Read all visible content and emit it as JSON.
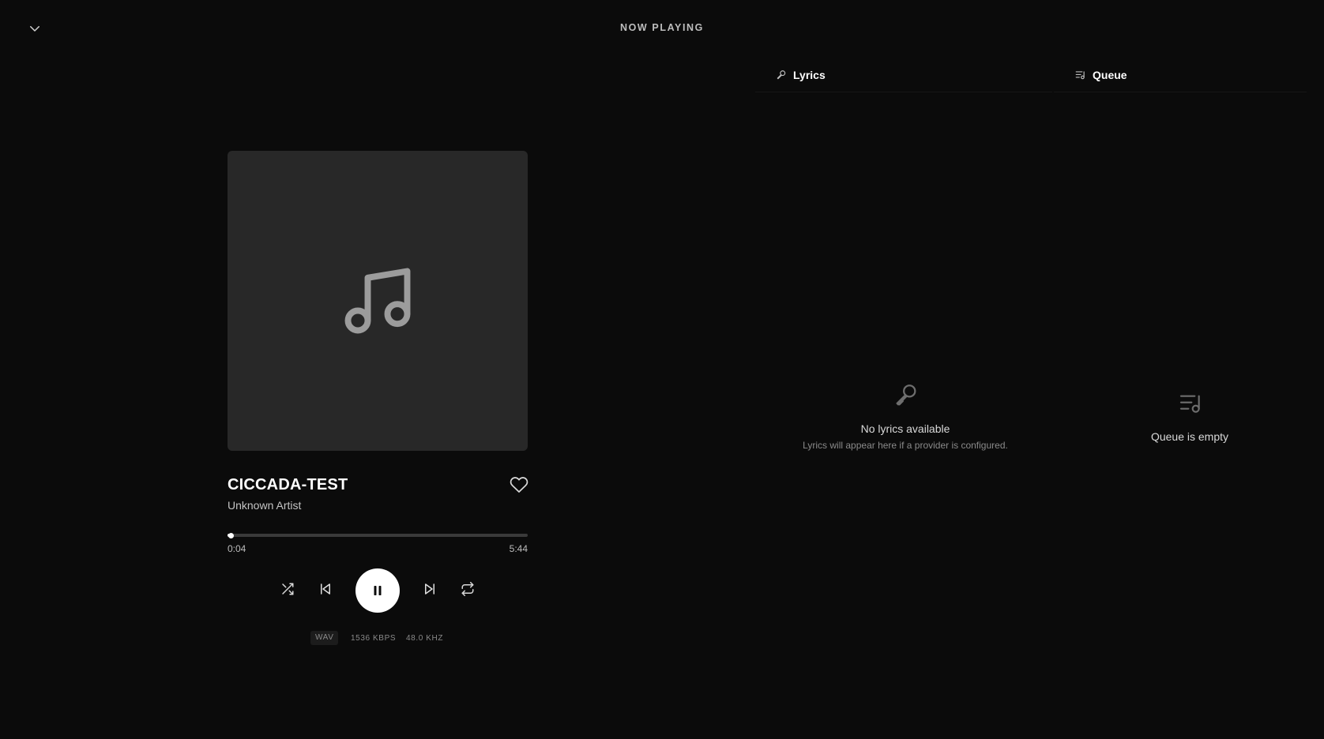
{
  "header": {
    "title": "NOW PLAYING",
    "collapse_icon": "chevron-down-icon"
  },
  "track": {
    "title": "CICCADA-TEST",
    "artist": "Unknown Artist",
    "artwork_icon": "music-note-icon",
    "favorite_icon": "heart-outline-icon"
  },
  "playback": {
    "elapsed": "0:04",
    "duration": "5:44",
    "progress_fraction": 0.0116,
    "state": "playing"
  },
  "controls": {
    "shuffle_icon": "shuffle-icon",
    "previous_icon": "skip-previous-icon",
    "play_pause_icon": "pause-icon",
    "next_icon": "skip-next-icon",
    "repeat_icon": "repeat-icon"
  },
  "audio_info": {
    "format": "WAV",
    "bitrate": "1536 KBPS",
    "sample_rate": "48.0 KHZ"
  },
  "tabs": [
    {
      "label": "Lyrics",
      "icon": "microphone-icon"
    },
    {
      "label": "Queue",
      "icon": "queue-icon"
    }
  ],
  "lyrics": {
    "empty_title": "No lyrics available",
    "empty_subtitle": "Lyrics will appear here if a provider is configured."
  },
  "queue": {
    "empty_title": "Queue is empty"
  },
  "colors": {
    "background": "#0b0b0b",
    "artwork_bg": "#282828",
    "accent": "#ffffff",
    "muted_text": "#8a8a8a"
  }
}
